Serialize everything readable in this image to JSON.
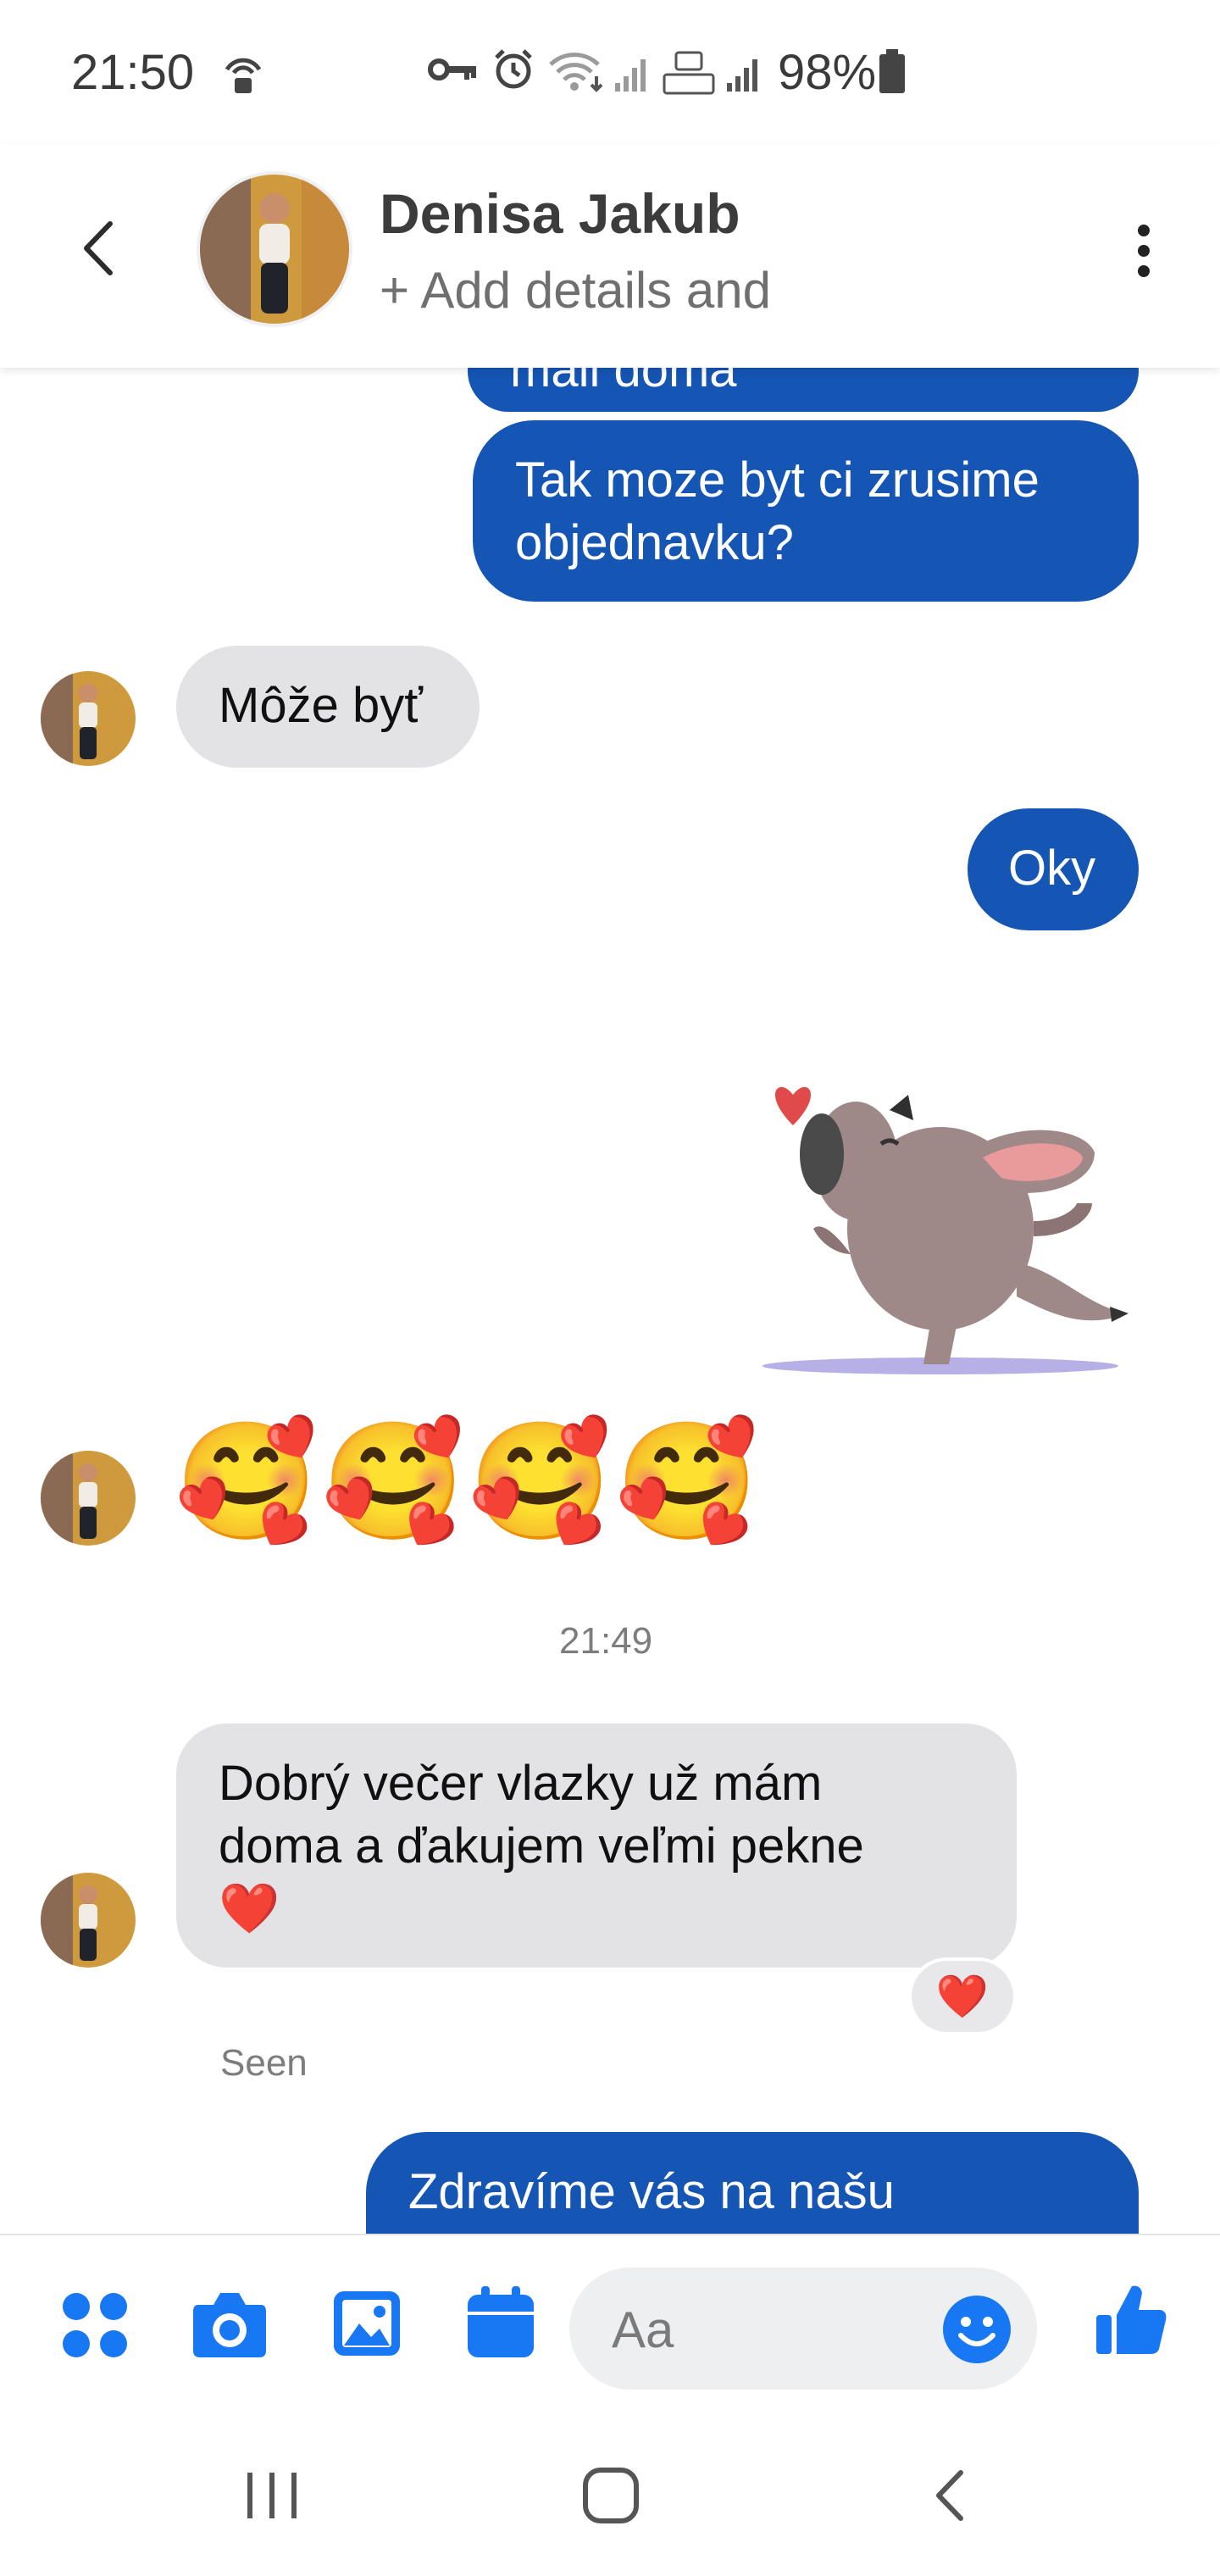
{
  "status_bar": {
    "time": "21:50",
    "battery": "98%"
  },
  "header": {
    "contact_name": "Denisa Jakub",
    "subtitle": "+ Add details and"
  },
  "colors": {
    "accent": "#1877f2",
    "outgoing_bubble": "#1555b4",
    "incoming_bubble": "#e3e3e5"
  },
  "messages": {
    "partial_top": "mali doma",
    "out_1": [
      "Tak moze byt ci zrusime",
      "objednavku?"
    ],
    "in_1": "Môže byť",
    "out_2": "Oky",
    "in_emojis": "🥰🥰🥰🥰",
    "timestamp": "21:49",
    "in_2": [
      "Dobrý večer vlazky už mám",
      "doma a ďakujem veľmi pekne"
    ],
    "in_2_emoji": "❤️",
    "reaction": "❤️",
    "seen": "Seen",
    "out_3": "Zdravíme vás na našu"
  },
  "composer": {
    "placeholder": "Aa"
  },
  "icons": [
    "back-arrow-icon",
    "more-options-icon",
    "apps-icon",
    "camera-icon",
    "gallery-icon",
    "calendar-icon",
    "emoji-icon",
    "like-icon",
    "recents-icon",
    "home-icon",
    "nav-back-icon"
  ]
}
